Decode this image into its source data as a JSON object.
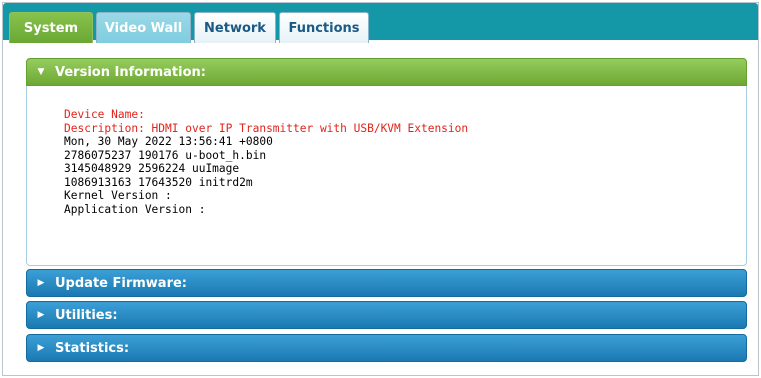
{
  "tabs": [
    {
      "label": "System",
      "state": "active"
    },
    {
      "label": "Video Wall",
      "state": "faded"
    },
    {
      "label": "Network",
      "state": "normal"
    },
    {
      "label": "Functions",
      "state": "normal"
    }
  ],
  "version_panel": {
    "title": "Version Information:",
    "lines": {
      "device_name": "Device Name:",
      "description": "Description: HDMI over IP Transmitter with USB/KVM Extension",
      "build_date": "Mon, 30 May 2022 13:56:41 +0800",
      "uboot": "2786075237 190176 u-boot_h.bin",
      "uimage": "3145048929 2596224 uuImage",
      "initrd": "1086913163 17643520 initrd2m",
      "kernel": "Kernel Version :",
      "application": "Application Version :"
    },
    "highlight_color": "#e0241b"
  },
  "collapsed_panels": [
    {
      "title": "Update Firmware:"
    },
    {
      "title": "Utilities:"
    },
    {
      "title": "Statistics:"
    }
  ],
  "colors": {
    "tabbar": "#1497a6",
    "active_tab": "#6aa734",
    "panel_green": "#7ab642",
    "panel_blue": "#1f80bb"
  }
}
